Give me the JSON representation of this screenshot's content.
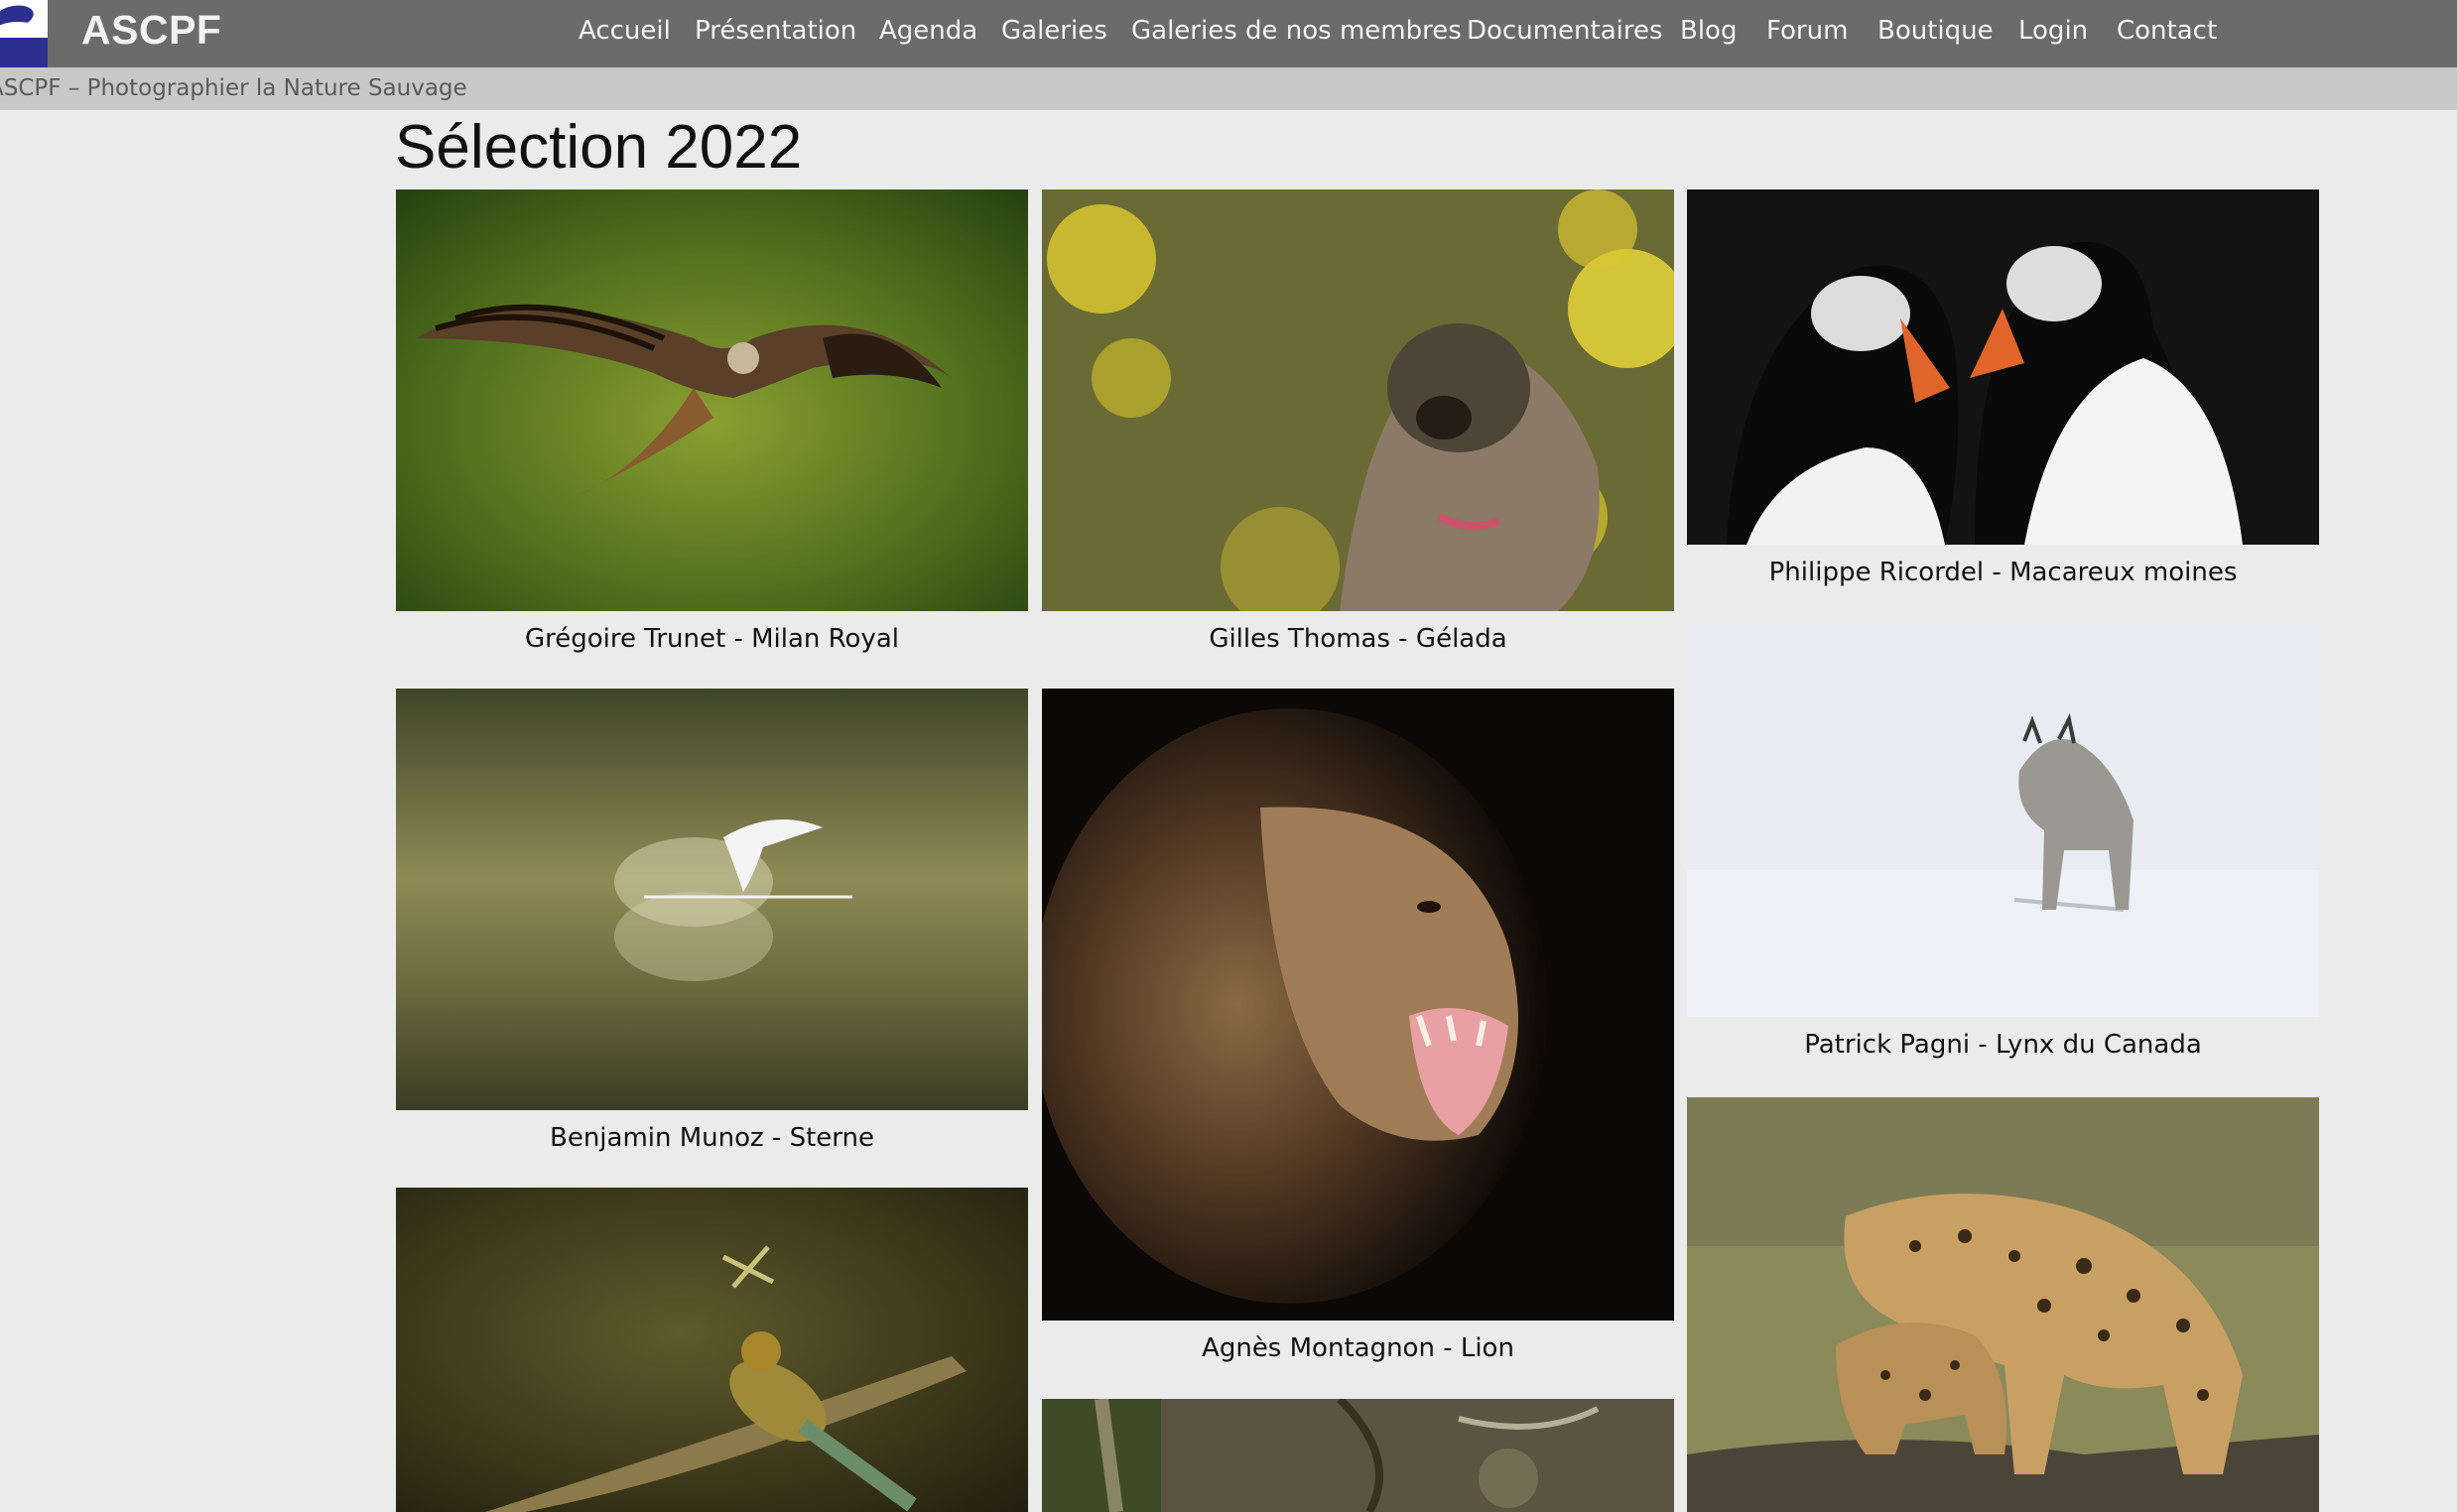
{
  "site": {
    "brand": "ASCPF",
    "tagline": "ASCPF – Photographier la Nature Sauvage",
    "logo_icon": "bird-logo-icon"
  },
  "nav": {
    "items": [
      {
        "label": "Accueil"
      },
      {
        "label": "Présentation"
      },
      {
        "label": "Agenda"
      },
      {
        "label": "Galeries"
      },
      {
        "label": "Galeries de nos membres"
      },
      {
        "label": "Documentaires"
      },
      {
        "label": "Blog"
      },
      {
        "label": "Forum"
      },
      {
        "label": "Boutique"
      },
      {
        "label": "Login"
      },
      {
        "label": "Contact"
      }
    ]
  },
  "page": {
    "title": "Sélection 2022"
  },
  "gallery": {
    "photos": [
      {
        "caption": "Grégoire Trunet - Milan Royal",
        "subject": "red kite in flight"
      },
      {
        "caption": "Gilles Thomas - Gélada",
        "subject": "gelada among yellow flowers"
      },
      {
        "caption": "Philippe Ricordel - Macareux moines",
        "subject": "two puffins"
      },
      {
        "caption": "Benjamin Munoz - Sterne",
        "subject": "tern diving in water"
      },
      {
        "caption": "Agnès Montagnon - Lion",
        "subject": "roaring lion"
      },
      {
        "caption": "Patrick Pagni - Lynx du Canada",
        "subject": "lynx on snow"
      },
      {
        "caption": "",
        "subject": "bee-eater catching dragonfly"
      },
      {
        "caption": "",
        "subject": "forest branches"
      },
      {
        "caption": "",
        "subject": "leopard with cub"
      }
    ]
  }
}
